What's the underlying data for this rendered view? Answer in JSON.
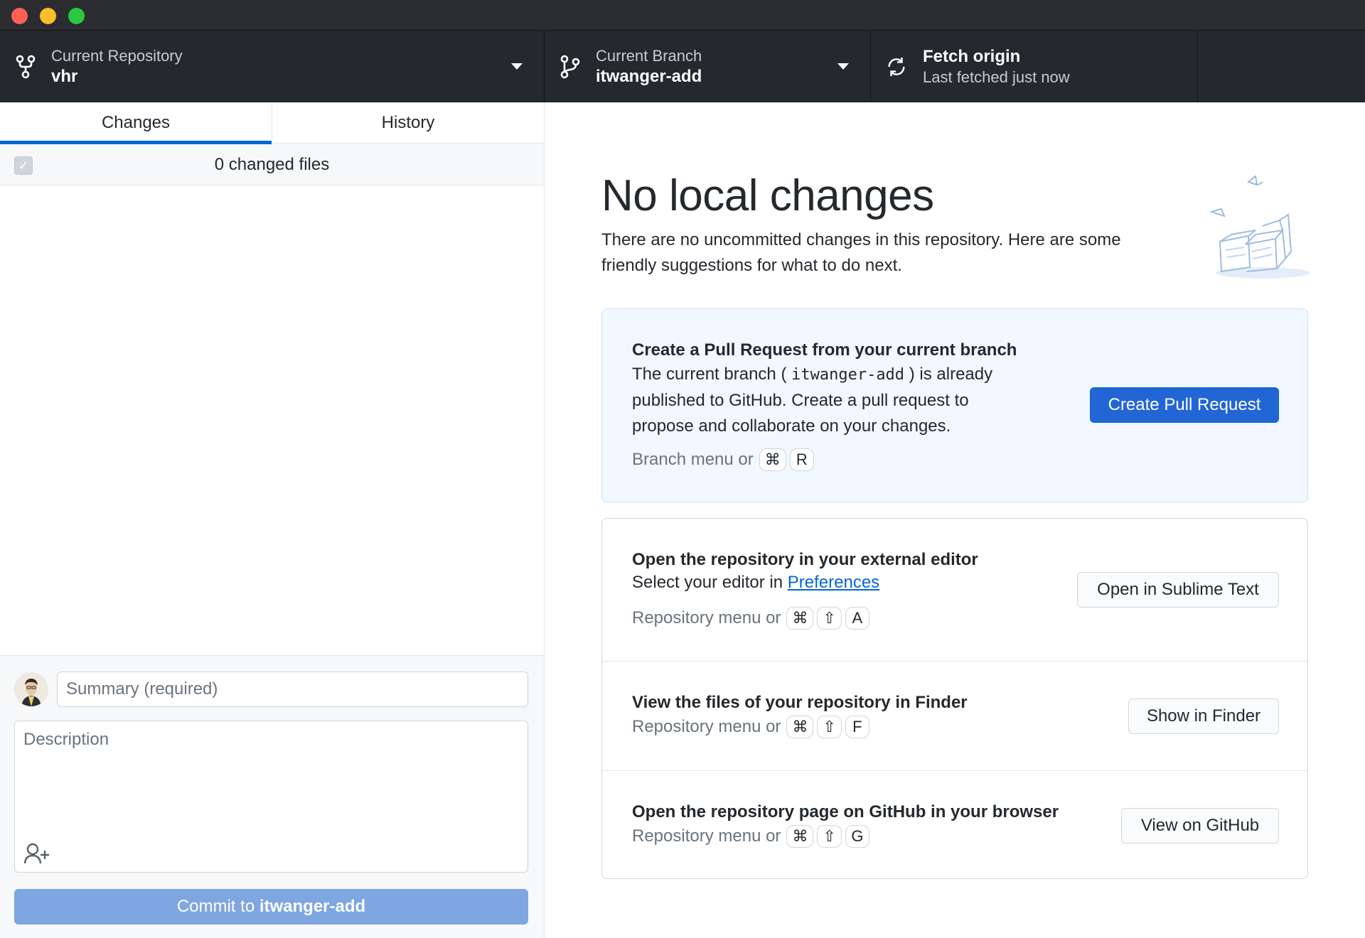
{
  "toolbar": {
    "repo_label": "Current Repository",
    "repo_name": "vhr",
    "branch_label": "Current Branch",
    "branch_name": "itwanger-add",
    "fetch_title": "Fetch origin",
    "fetch_status": "Last fetched just now"
  },
  "sidebar": {
    "tabs": [
      {
        "label": "Changes"
      },
      {
        "label": "History"
      }
    ],
    "changed_files": "0 changed files",
    "summary_placeholder": "Summary (required)",
    "description_placeholder": "Description",
    "commit_prefix": "Commit to ",
    "commit_branch": "itwanger-add"
  },
  "main": {
    "title": "No local changes",
    "subtitle": "There are no uncommitted changes in this repository. Here are some friendly suggestions for what to do next.",
    "pr_card": {
      "title": "Create a Pull Request from your current branch",
      "text_pre": "The current branch (",
      "text_branch": "itwanger-add",
      "text_post": ") is already published to GitHub. Create a pull request to propose and collaborate on your changes.",
      "hint": "Branch menu or",
      "keys": [
        "⌘",
        "R"
      ],
      "button": "Create Pull Request"
    },
    "editor_card": {
      "title": "Open the repository in your external editor",
      "text_pre": "Select your editor in ",
      "text_link": "Preferences",
      "hint": "Repository menu or",
      "keys": [
        "⌘",
        "⇧",
        "A"
      ],
      "button": "Open in Sublime Text"
    },
    "finder_card": {
      "title": "View the files of your repository in Finder",
      "hint": "Repository menu or",
      "keys": [
        "⌘",
        "⇧",
        "F"
      ],
      "button": "Show in Finder"
    },
    "github_card": {
      "title": "Open the repository page on GitHub in your browser",
      "hint": "Repository menu or",
      "keys": [
        "⌘",
        "⇧",
        "G"
      ],
      "button": "View on GitHub"
    }
  },
  "colors": {
    "toolbar_bg": "#24292e",
    "accent": "#0366d6",
    "commit_button": "#7ea6e0"
  }
}
